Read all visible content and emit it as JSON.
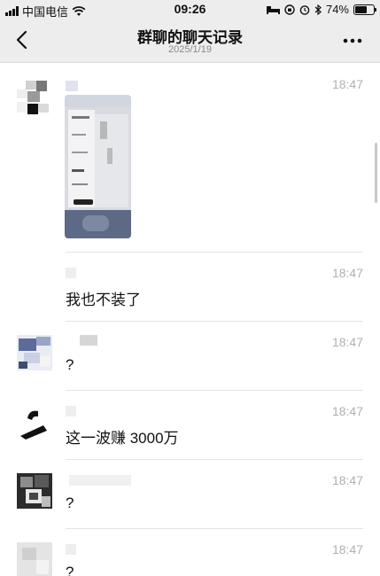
{
  "status_bar": {
    "carrier": "中国电信",
    "time": "09:26",
    "battery_text": "74%",
    "battery_level": 0.74
  },
  "nav": {
    "title": "群聊的聊天记录",
    "subtitle": "2025/1/19"
  },
  "messages": [
    {
      "time": "18:47",
      "text": ""
    },
    {
      "time": "18:47",
      "text": "我也不装了"
    },
    {
      "time": "18:47",
      "text": "?"
    },
    {
      "time": "18:47",
      "text": "这一波赚 3000万"
    },
    {
      "time": "18:47",
      "text": "?"
    },
    {
      "time": "18:47",
      "text": "?"
    }
  ],
  "icons": {
    "back": "chevron-left-icon",
    "more": "more-dots-icon",
    "wifi": "wifi-icon",
    "signal": "signal-icon",
    "battery": "battery-icon",
    "bed": "bed-icon",
    "lock": "orientation-lock-icon",
    "alarm": "alarm-icon",
    "bluetooth": "bluetooth-icon"
  }
}
